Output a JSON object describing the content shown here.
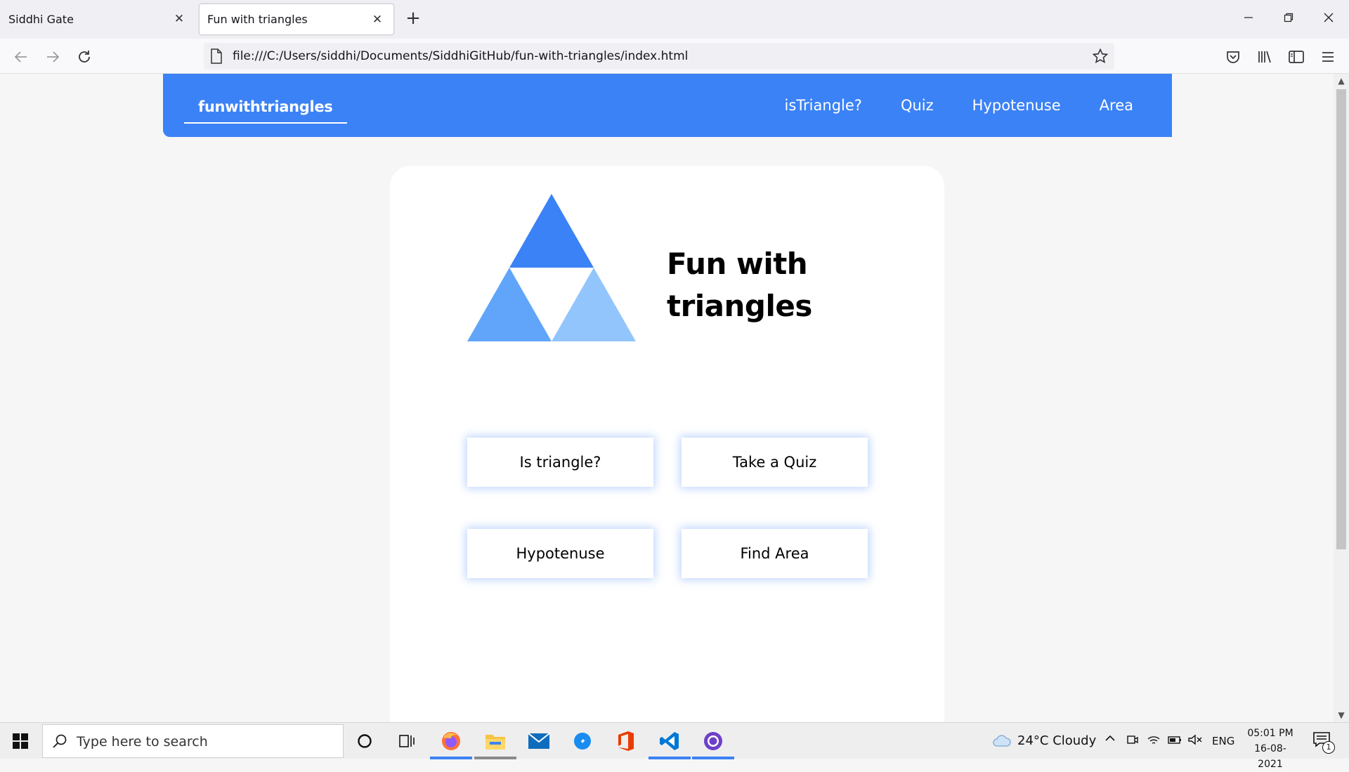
{
  "browser": {
    "tabs": [
      {
        "label": "Siddhi Gate",
        "active": false
      },
      {
        "label": "Fun with triangles",
        "active": true
      }
    ],
    "url": "file:///C:/Users/siddhi/Documents/SiddhiGitHub/fun-with-triangles/index.html",
    "icons": {
      "back": "arrow-left-icon",
      "forward": "arrow-right-icon",
      "reload": "reload-icon",
      "page": "page-icon",
      "bookmark": "star-icon",
      "pocket": "pocket-icon",
      "library": "library-icon",
      "sidebar": "sidebar-icon",
      "menu": "hamburger-icon",
      "minimize": "minimize-icon",
      "restore": "restore-icon",
      "close": "close-icon",
      "new_tab": "plus-icon"
    }
  },
  "site": {
    "brand": "funwithtriangles",
    "nav": [
      "isTriangle?",
      "Quiz",
      "Hypotenuse",
      "Area"
    ],
    "hero_title": "Fun with triangles",
    "tiles": [
      "Is triangle?",
      "Take a Quiz",
      "Hypotenuse",
      "Find Area"
    ],
    "colors": {
      "primary": "#3b82f6",
      "triangle_top": "#3b82f6",
      "triangle_left": "#60a5fa",
      "triangle_right": "#93c5fd"
    }
  },
  "taskbar": {
    "search_placeholder": "Type here to search",
    "weather": "24°C  Cloudy",
    "language": "ENG",
    "time": "05:01 PM",
    "date": "16-08-2021",
    "notification_count": "1",
    "apps": [
      "firefox-icon",
      "file-explorer-icon",
      "mail-icon",
      "browser-icon",
      "office-icon",
      "vscode-icon",
      "github-desktop-icon"
    ]
  }
}
